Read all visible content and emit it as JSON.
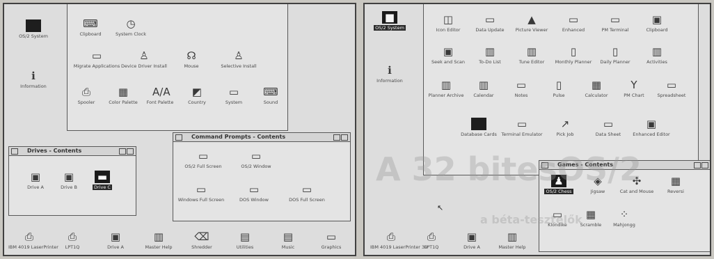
{
  "left": {
    "desktop": [
      {
        "label": "OS/2 System",
        "glyph": "■",
        "dark": true
      },
      {
        "label": "Information",
        "glyph": "ℹ",
        "dark": false
      }
    ],
    "system_setup": {
      "row1": [
        {
          "label": "Clipboard",
          "glyph": "⌨"
        },
        {
          "label": "System Clock",
          "glyph": "◷"
        }
      ],
      "row2": [
        {
          "label": "Migrate Applications",
          "glyph": "▭"
        },
        {
          "label": "Device Driver Install",
          "glyph": "♙"
        },
        {
          "label": "Mouse",
          "glyph": "☊"
        },
        {
          "label": "Selective Install",
          "glyph": "♙"
        }
      ],
      "row3": [
        {
          "label": "Spooler",
          "glyph": "⎙"
        },
        {
          "label": "Color Palette",
          "glyph": "▦"
        },
        {
          "label": "Font Palette",
          "glyph": "A/A"
        },
        {
          "label": "Country",
          "glyph": "◩"
        },
        {
          "label": "System",
          "glyph": "▭"
        },
        {
          "label": "Sound",
          "glyph": "⌨"
        }
      ]
    },
    "drives": {
      "title": "Drives - Contents",
      "items": [
        {
          "label": "Drive A",
          "glyph": "▣"
        },
        {
          "label": "Drive B",
          "glyph": "▣"
        },
        {
          "label": "Drive C",
          "glyph": "▬",
          "selected": true
        }
      ]
    },
    "prompts": {
      "title": "Command Prompts - Contents",
      "row1": [
        {
          "label": "OS/2 Full Screen",
          "glyph": "▭"
        },
        {
          "label": "OS/2 Window",
          "glyph": "▭"
        }
      ],
      "row2": [
        {
          "label": "Windows Full Screen",
          "glyph": "▭"
        },
        {
          "label": "DOS Window",
          "glyph": "▭"
        },
        {
          "label": "DOS Full Screen",
          "glyph": "▭"
        }
      ]
    },
    "taskbar": [
      {
        "label": "IBM 4019 LaserPrinter",
        "glyph": "⎙"
      },
      {
        "label": "LPT1Q",
        "glyph": "⎙"
      },
      {
        "label": "Drive A",
        "glyph": "▣"
      },
      {
        "label": "Master Help",
        "glyph": "▥"
      },
      {
        "label": "Shredder",
        "glyph": "⌫"
      },
      {
        "label": "Utilities",
        "glyph": "▤"
      },
      {
        "label": "Music",
        "glyph": "▤"
      },
      {
        "label": "Graphics",
        "glyph": "▭"
      }
    ]
  },
  "right": {
    "desktop": [
      {
        "label": "OS/2 System",
        "glyph": "■",
        "dark": true,
        "selected": true
      },
      {
        "label": "Information",
        "glyph": "ℹ",
        "dark": false
      }
    ],
    "productivity": {
      "row1": [
        {
          "label": "Icon Editor",
          "glyph": "◫"
        },
        {
          "label": "Data Update",
          "glyph": "▭"
        },
        {
          "label": "Picture Viewer",
          "glyph": "▲"
        },
        {
          "label": "Enhanced",
          "glyph": "▭"
        },
        {
          "label": "PM Terminal",
          "glyph": "▭"
        },
        {
          "label": "Clipboard",
          "glyph": "▣"
        }
      ],
      "row2": [
        {
          "label": "Seek and Scan",
          "glyph": "▣"
        },
        {
          "label": "To-Do List",
          "glyph": "▥"
        },
        {
          "label": "Tune Editor",
          "glyph": "▥"
        },
        {
          "label": "Monthly Planner",
          "glyph": "▯"
        },
        {
          "label": "Daily Planner",
          "glyph": "▯"
        },
        {
          "label": "Activities",
          "glyph": "▥"
        }
      ],
      "row3": [
        {
          "label": "Planner Archive",
          "glyph": "▥"
        },
        {
          "label": "Calendar",
          "glyph": "▥"
        },
        {
          "label": "Notes",
          "glyph": "▭"
        },
        {
          "label": "Pulse",
          "glyph": "▯"
        },
        {
          "label": "Calculator",
          "glyph": "▦"
        },
        {
          "label": "PM Chart",
          "glyph": "Y"
        },
        {
          "label": "Spreadsheet",
          "glyph": "▭"
        }
      ],
      "row4": [
        {
          "label": "Database Cards",
          "glyph": "■",
          "dark": true
        },
        {
          "label": "Terminal Emulator",
          "glyph": "▭"
        },
        {
          "label": "Pick Job",
          "glyph": "↗"
        },
        {
          "label": "Data Sheet",
          "glyph": "▭"
        },
        {
          "label": "Enhanced Editor",
          "glyph": "▣"
        }
      ]
    },
    "games": {
      "title": "Games - Contents",
      "row1": [
        {
          "label": "OS/2 Chess",
          "glyph": "♟",
          "selected": true
        },
        {
          "label": "Jigsaw",
          "glyph": "◈"
        },
        {
          "label": "Cat and Mouse",
          "glyph": "✣"
        },
        {
          "label": "Reversi",
          "glyph": "▦"
        }
      ],
      "row2": [
        {
          "label": "Klondike",
          "glyph": "▭"
        },
        {
          "label": "Scramble",
          "glyph": "▦"
        },
        {
          "label": "Mahjongg",
          "glyph": "⁘"
        }
      ]
    },
    "taskbar": [
      {
        "label": "IBM 4019 LaserPrinter 39",
        "glyph": "⎙"
      },
      {
        "label": "LPT1Q",
        "glyph": "⎙"
      },
      {
        "label": "Drive A",
        "glyph": "▣"
      },
      {
        "label": "Master Help",
        "glyph": "▥"
      }
    ]
  },
  "bleed": [
    {
      "text": "A 32 bitesOS/2"
    },
    {
      "text": "a béta-tesztelők"
    }
  ]
}
